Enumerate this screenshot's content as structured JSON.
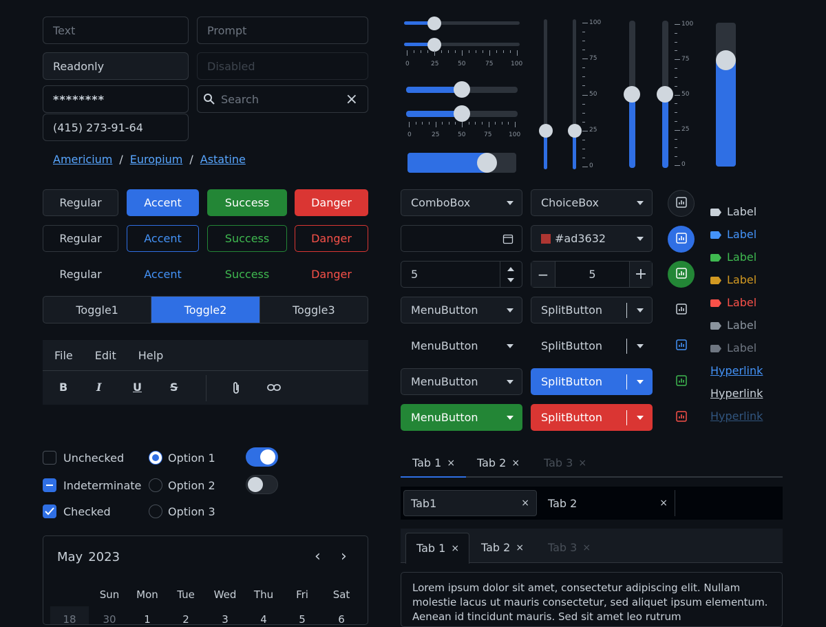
{
  "inputs": {
    "text_ph": "Text",
    "prompt_ph": "Prompt",
    "readonly": "Readonly",
    "disabled_ph": "Disabled",
    "password": "********",
    "search_ph": "Search",
    "phone": "(415) 273-91-64"
  },
  "breadcrumb": [
    "Americium",
    "Europium",
    "Astatine"
  ],
  "breadcrumb_sep": "/",
  "buttons": {
    "regular": "Regular",
    "accent": "Accent",
    "success": "Success",
    "danger": "Danger"
  },
  "toggles": [
    "Toggle1",
    "Toggle2",
    "Toggle3"
  ],
  "toggle_selected": 1,
  "menubar": [
    "File",
    "Edit",
    "Help"
  ],
  "sliders": {
    "small_ticks": [
      "0",
      "25",
      "50",
      "75",
      "100"
    ],
    "vertical_ticks": [
      "100",
      "75",
      "50",
      "25",
      "0"
    ],
    "h_values": [
      25,
      25,
      50,
      50,
      75
    ],
    "v_values": [
      25,
      25,
      50,
      50,
      75
    ]
  },
  "combos": {
    "combobox": "ComboBox",
    "choicebox": "ChoiceBox",
    "color": "#ad3632",
    "color_swatch": "#ad3632",
    "spin1": "5",
    "spin2": "5",
    "menubutton": "MenuButton",
    "splitbutton": "SplitButton",
    "minus": "−",
    "plus": "+"
  },
  "labels": [
    "Label",
    "Label",
    "Label",
    "Label",
    "Label",
    "Label",
    "Label"
  ],
  "label_colors": [
    "#c9d1d9",
    "#4493f8",
    "#3fb950",
    "#d29922",
    "#f85149",
    "#8b949e",
    "#6e7681"
  ],
  "hyperlinks": [
    "Hyperlink",
    "Hyperlink",
    "Hyperlink"
  ],
  "checks": {
    "unchecked": "Unchecked",
    "indeterminate": "Indeterminate",
    "checked": "Checked"
  },
  "radios": [
    "Option 1",
    "Option 2",
    "Option 3"
  ],
  "switches": [
    true,
    false
  ],
  "tabs1": [
    "Tab 1",
    "Tab 2",
    "Tab 3"
  ],
  "tabs2": [
    "Tab1",
    "Tab 2"
  ],
  "tabs3": [
    "Tab 1",
    "Tab 2",
    "Tab 3"
  ],
  "close": "×",
  "textarea": "Lorem ipsum dolor sit amet, consectetur adipiscing elit. Nullam molestie lacus ut mauris consectetur, sed aliquet ipsum elementum. Aenean id tincidunt mauris. Sed sit amet leo rutrum",
  "calendar": {
    "month": "May",
    "year": "2023",
    "weekdays": [
      "Sun",
      "Mon",
      "Tue",
      "Wed",
      "Thu",
      "Fri",
      "Sat"
    ],
    "week_no": "18",
    "row1": [
      "30",
      "1",
      "2",
      "3",
      "4",
      "5",
      "6"
    ]
  },
  "colors": {
    "accent": "#2f6fe4",
    "success": "#238636",
    "danger": "#da3633",
    "bg": "#0d1117"
  }
}
